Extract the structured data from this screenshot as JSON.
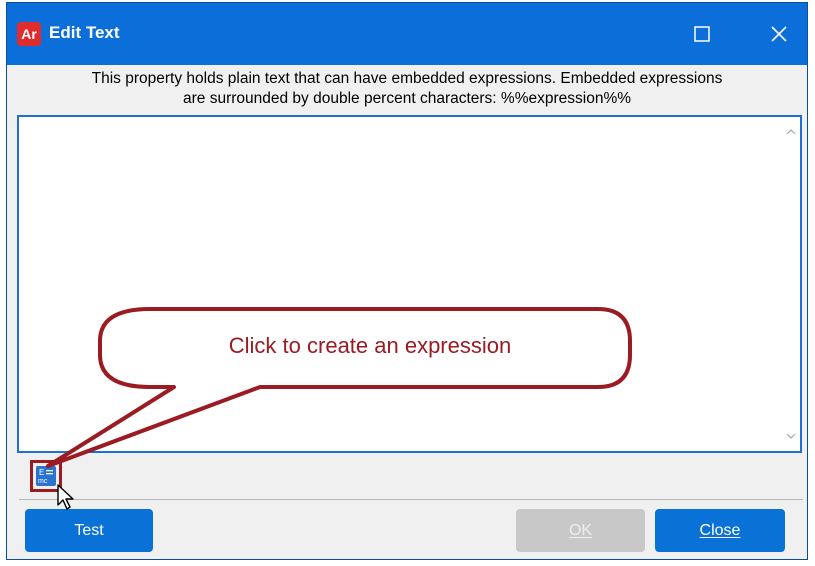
{
  "window": {
    "app_icon_label": "Ar",
    "title": "Edit Text"
  },
  "description": {
    "line1": "This property holds plain text that can have embedded expressions.  Embedded expressions",
    "line2": "are surrounded by double percent characters: %%expression%%"
  },
  "editor": {
    "value": ""
  },
  "callout": {
    "text": "Click to create an expression"
  },
  "buttons": {
    "test": "Test",
    "ok": "OK",
    "close": "Close"
  },
  "icons": {
    "app": "app-icon",
    "maximize": "maximize-icon",
    "close": "close-icon",
    "expression": "expression-icon",
    "scroll_up": "chevron-up-icon",
    "scroll_down": "chevron-down-icon",
    "cursor": "mouse-cursor-icon"
  },
  "colors": {
    "titlebar": "#0c6fd9",
    "primary_button": "#0a72d6",
    "disabled_button": "#c8c8c8",
    "callout_border": "#9a1b22",
    "editor_border": "#1e6fd6"
  }
}
